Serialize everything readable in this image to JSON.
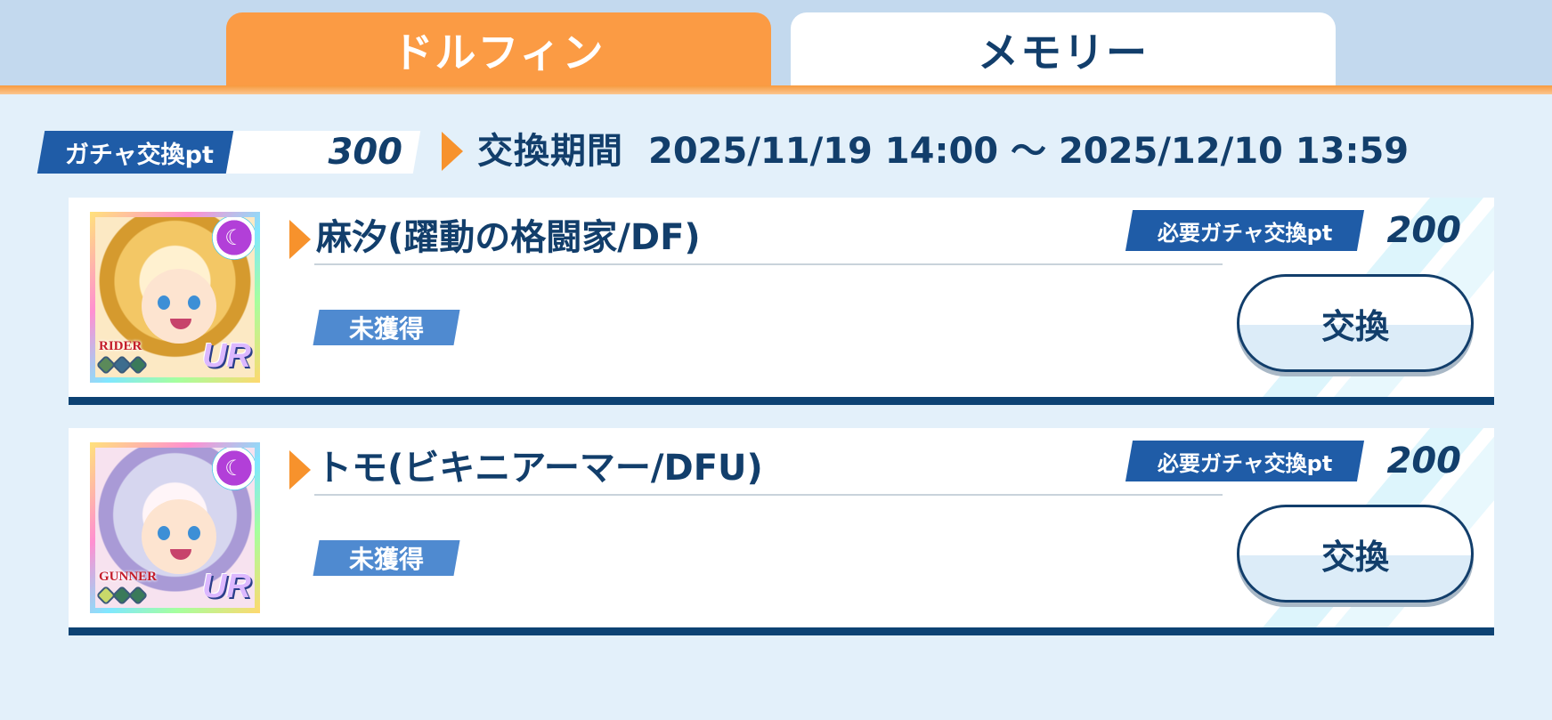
{
  "tabs": [
    {
      "label": "ドルフィン",
      "active": true
    },
    {
      "label": "メモリー",
      "active": false
    }
  ],
  "points": {
    "label": "ガチャ交換pt",
    "value": "300"
  },
  "period": {
    "label": "交換期間",
    "range": "2025/11/19 14:00 ～ 2025/12/10 13:59"
  },
  "items": [
    {
      "name": "麻汐(躍動の格闘家/DF)",
      "status": "未獲得",
      "required_label": "必要ガチャ交換pt",
      "required_value": "200",
      "button_label": "交換",
      "role": "RIDER",
      "rarity": "UR"
    },
    {
      "name": "トモ(ビキニアーマー/DFU)",
      "status": "未獲得",
      "required_label": "必要ガチャ交換pt",
      "required_value": "200",
      "button_label": "交換",
      "role": "GUNNER",
      "rarity": "UR"
    }
  ],
  "colors": {
    "accent_orange": "#fb9b44",
    "navy": "#123e6b",
    "badge_blue": "#1f5ca7",
    "status_blue": "#4f8ad0",
    "background": "#e3f0fa"
  }
}
